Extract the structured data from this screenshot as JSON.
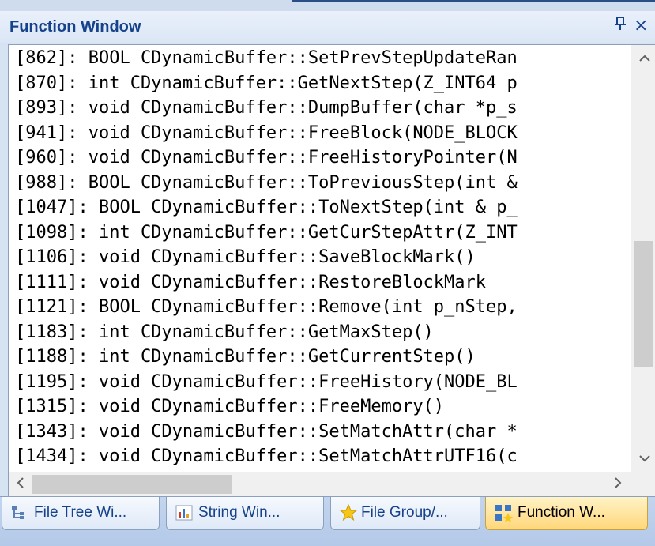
{
  "panel": {
    "title": "Function Window",
    "pin_glyph": "Ĥ",
    "close_glyph": "×"
  },
  "functions": [
    {
      "line": "[862]: BOOL CDynamicBuffer::SetPrevStepUpdateRan"
    },
    {
      "line": "[870]: int CDynamicBuffer::GetNextStep(Z_INT64 p"
    },
    {
      "line": "[893]: void CDynamicBuffer::DumpBuffer(char *p_s"
    },
    {
      "line": "[941]: void CDynamicBuffer::FreeBlock(NODE_BLOCK"
    },
    {
      "line": "[960]: void CDynamicBuffer::FreeHistoryPointer(N"
    },
    {
      "line": "[988]: BOOL CDynamicBuffer::ToPreviousStep(int &"
    },
    {
      "line": "[1047]: BOOL CDynamicBuffer::ToNextStep(int & p_"
    },
    {
      "line": "[1098]: int CDynamicBuffer::GetCurStepAttr(Z_INT"
    },
    {
      "line": "[1106]: void     CDynamicBuffer::SaveBlockMark()"
    },
    {
      "line": "[1111]: void     CDynamicBuffer::RestoreBlockMark"
    },
    {
      "line": "[1121]: BOOL CDynamicBuffer::Remove(int p_nStep,"
    },
    {
      "line": "[1183]: int CDynamicBuffer::GetMaxStep()"
    },
    {
      "line": "[1188]: int CDynamicBuffer::GetCurrentStep()"
    },
    {
      "line": "[1195]: void CDynamicBuffer::FreeHistory(NODE_BL"
    },
    {
      "line": "[1315]: void CDynamicBuffer::FreeMemory()"
    },
    {
      "line": "[1343]: void CDynamicBuffer::SetMatchAttr(char *"
    },
    {
      "line": "[1434]: void CDynamicBuffer::SetMatchAttrUTF16(c"
    }
  ],
  "scrollbars": {
    "up_glyph": "˄",
    "down_glyph": "˅",
    "left_glyph": "<",
    "right_glyph": ">"
  },
  "tabs": [
    {
      "label": "File Tree Wi...",
      "icon": "file-tree-icon",
      "active": false
    },
    {
      "label": "String Win...",
      "icon": "string-chart-icon",
      "active": false
    },
    {
      "label": "File Group/...",
      "icon": "star-icon",
      "active": false
    },
    {
      "label": "Function W...",
      "icon": "function-icon",
      "active": true
    }
  ],
  "colors": {
    "title_text": "#15428b",
    "active_tab": "#ffd77a"
  }
}
